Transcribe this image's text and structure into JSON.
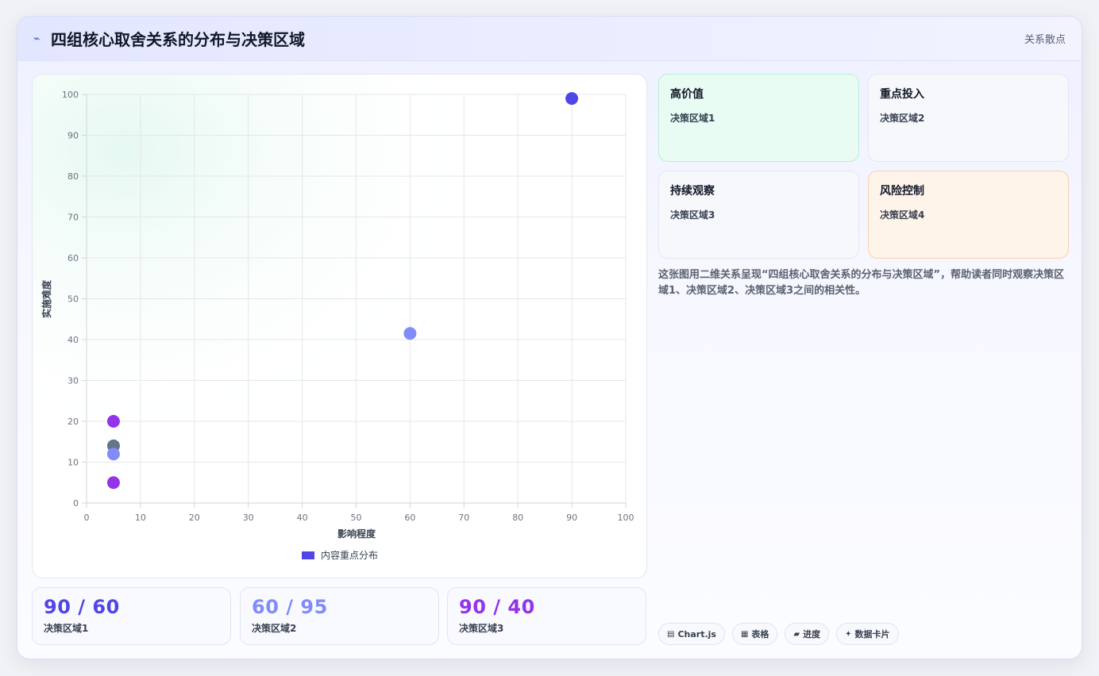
{
  "header": {
    "icon": "bolt-icon",
    "title": "四组核心取舍关系的分布与决策区域",
    "tag": "关系散点"
  },
  "chart_data": {
    "type": "scatter",
    "xlabel": "影响程度",
    "ylabel": "实施难度",
    "xlim": [
      0,
      100
    ],
    "ylim": [
      0,
      100
    ],
    "xticks": [
      0,
      10,
      20,
      30,
      40,
      50,
      60,
      70,
      80,
      90,
      100
    ],
    "yticks": [
      0,
      10,
      20,
      30,
      40,
      50,
      60,
      70,
      80,
      90,
      100
    ],
    "grid": true,
    "legend": "bottom",
    "series": [
      {
        "name": "内容重点分布",
        "color": "#4f46e5",
        "points": [
          {
            "x": 90,
            "y": 99,
            "color": "#4f46e5"
          },
          {
            "x": 60,
            "y": 41.5,
            "color": "#818cf8"
          },
          {
            "x": 5,
            "y": 20,
            "color": "#9333ea"
          },
          {
            "x": 5,
            "y": 14,
            "color": "#64748b"
          },
          {
            "x": 5,
            "y": 12,
            "color": "#818cf8"
          },
          {
            "x": 5,
            "y": 5,
            "color": "#9333ea"
          }
        ]
      }
    ]
  },
  "stats": [
    {
      "value": "90 / 60",
      "label": "决策区域1",
      "color": "#4f46e5"
    },
    {
      "value": "60 / 95",
      "label": "决策区域2",
      "color": "#818cf8"
    },
    {
      "value": "90 / 40",
      "label": "决策区域3",
      "color": "#9333ea"
    }
  ],
  "quadrants": [
    {
      "title": "高价值",
      "sub": "决策区域1"
    },
    {
      "title": "重点投入",
      "sub": "决策区域2"
    },
    {
      "title": "持续观察",
      "sub": "决策区域3"
    },
    {
      "title": "风险控制",
      "sub": "决策区域4"
    }
  ],
  "description": "这张图用二维关系呈现“四组核心取舍关系的分布与决策区域”，帮助读者同时观察决策区域1、决策区域2、决策区域3之间的相关性。",
  "chips": [
    {
      "icon": "chart-icon",
      "label": "Chart.js"
    },
    {
      "icon": "table-icon",
      "label": "表格"
    },
    {
      "icon": "progress-icon",
      "label": "进度"
    },
    {
      "icon": "sparkle-icon",
      "label": "数据卡片"
    }
  ]
}
